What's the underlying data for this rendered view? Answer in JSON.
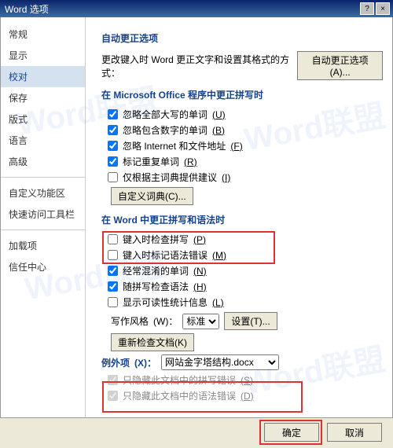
{
  "titlebar": {
    "title": "Word 选项"
  },
  "sidebar": {
    "items": [
      "常规",
      "显示",
      "校对",
      "保存",
      "版式",
      "语言",
      "高级"
    ],
    "items2": [
      "自定义功能区",
      "快速访问工具栏"
    ],
    "items3": [
      "加载项",
      "信任中心"
    ],
    "selected_index": 2
  },
  "main": {
    "sec1": "自动更正选项",
    "row1_label": "更改键入时 Word 更正文字和设置其格式的方式：",
    "row1_btn": "自动更正选项(A)...",
    "sec2": "在 Microsoft Office 程序中更正拼写时",
    "cb1": {
      "label": "忽略全部大写的单词",
      "key": "(U)",
      "checked": true
    },
    "cb2": {
      "label": "忽略包含数字的单词",
      "key": "(B)",
      "checked": true
    },
    "cb3": {
      "label": "忽略 Internet 和文件地址",
      "key": "(F)",
      "checked": true
    },
    "cb4": {
      "label": "标记重复单词",
      "key": "(R)",
      "checked": true
    },
    "cb5": {
      "label": "仅根据主词典提供建议",
      "key": "(I)",
      "checked": false
    },
    "btn_dict": "自定义词典(C)...",
    "sec3": "在 Word 中更正拼写和语法时",
    "cb6": {
      "label": "键入时检查拼写",
      "key": "(P)",
      "checked": false
    },
    "cb7": {
      "label": "键入时标记语法错误",
      "key": "(M)",
      "checked": false
    },
    "cb8": {
      "label": "经常混淆的单词",
      "key": "(N)",
      "checked": true
    },
    "cb9": {
      "label": "随拼写检查语法",
      "key": "(H)",
      "checked": true
    },
    "cb10": {
      "label": "显示可读性统计信息",
      "key": "(L)",
      "checked": false
    },
    "style_label": "写作风格",
    "style_key": "(W)：",
    "style_value": "标准",
    "style_btn": "设置(T)...",
    "recheck_btn": "重新检查文档(K)",
    "sec4_label": "例外项",
    "sec4_key": "(X)：",
    "doc_value": "网站金字塔结构.docx",
    "cb11": {
      "label": "只隐藏此文档中的拼写错误",
      "key": "(S)",
      "checked": true
    },
    "cb12": {
      "label": "只隐藏此文档中的语法错误",
      "key": "(D)",
      "checked": true
    }
  },
  "footer": {
    "ok": "确定",
    "cancel": "取消"
  },
  "watermark": "Word联盟"
}
